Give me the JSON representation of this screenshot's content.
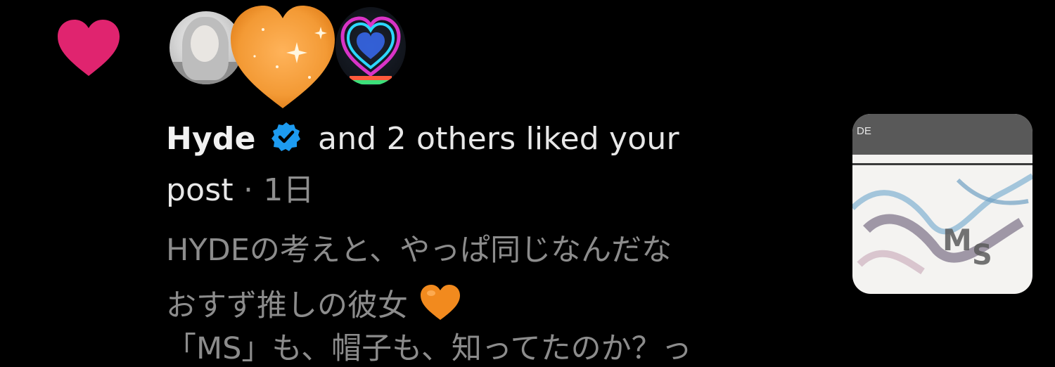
{
  "notification": {
    "user": "Hyde",
    "action_text": "and 2 others liked your",
    "action_text_2": "post",
    "separator": " · ",
    "time": "1日"
  },
  "post": {
    "line1": "HYDEの考えと、やっぱ同じなんだな",
    "line2": "おすず推しの彼女",
    "line3": "「MS」も、帽子も、知ってたのか？っ"
  },
  "thumbnail": {
    "label": "DE"
  },
  "colors": {
    "background": "#000000",
    "like_heart": "#e0246f",
    "verified_badge": "#1d9bf0",
    "orange_heart": "#f28a1e",
    "text_primary": "#f1f1f1",
    "text_secondary": "#8f8f8f"
  },
  "icons": {
    "like": "heart-icon",
    "verified": "verified-badge-icon",
    "emoji": "orange-heart-emoji-icon"
  }
}
